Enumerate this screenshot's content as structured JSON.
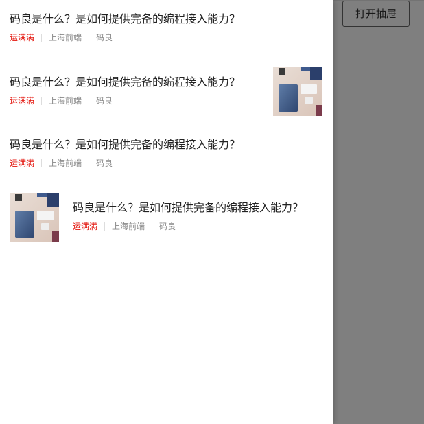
{
  "header": {
    "open_drawer_label": "打开抽屉"
  },
  "articles": [
    {
      "title": "码良是什么？是如何提供完备的编程接入能力？",
      "tag": "运满满",
      "group": "上海前端",
      "author": "码良",
      "thumbnail": "none"
    },
    {
      "title": "码良是什么？是如何提供完备的编程接入能力？",
      "tag": "运满满",
      "group": "上海前端",
      "author": "码良",
      "thumbnail": "right"
    },
    {
      "title": "码良是什么？是如何提供完备的编程接入能力？",
      "tag": "运满满",
      "group": "上海前端",
      "author": "码良",
      "thumbnail": "none"
    },
    {
      "title": "码良是什么？是如何提供完备的编程接入能力？",
      "tag": "运满满",
      "group": "上海前端",
      "author": "码良",
      "thumbnail": "left"
    }
  ],
  "colors": {
    "tag": "#e4170f",
    "meta": "#888888",
    "title": "#222222",
    "mask": "rgba(0,0,0,0.5)"
  }
}
